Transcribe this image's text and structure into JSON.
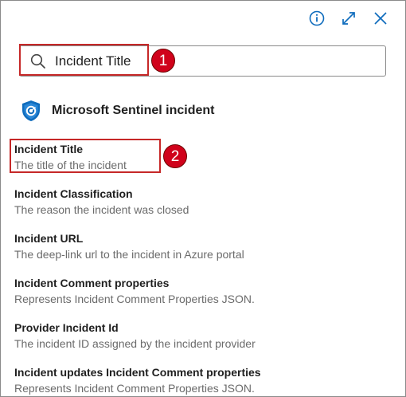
{
  "header": {
    "info_icon": "info-icon",
    "expand_icon": "expand-icon",
    "close_icon": "close-icon"
  },
  "search": {
    "value": "Incident Title",
    "callout_number": "1"
  },
  "section": {
    "title": "Microsoft Sentinel incident",
    "icon": "sentinel-shield-icon"
  },
  "items": [
    {
      "title": "Incident Title",
      "description": "The title of the incident"
    },
    {
      "title": "Incident Classification",
      "description": "The reason the incident was closed"
    },
    {
      "title": "Incident URL",
      "description": "The deep-link url to the incident in Azure portal"
    },
    {
      "title": "Incident Comment properties",
      "description": "Represents Incident Comment Properties JSON."
    },
    {
      "title": "Provider Incident Id",
      "description": "The incident ID assigned by the incident provider"
    },
    {
      "title": "Incident updates Incident Comment properties",
      "description": "Represents Incident Comment Properties JSON."
    }
  ],
  "item_callout_number": "2",
  "colors": {
    "accent_blue": "#0f6cbd",
    "callout_red": "#d0021b"
  }
}
